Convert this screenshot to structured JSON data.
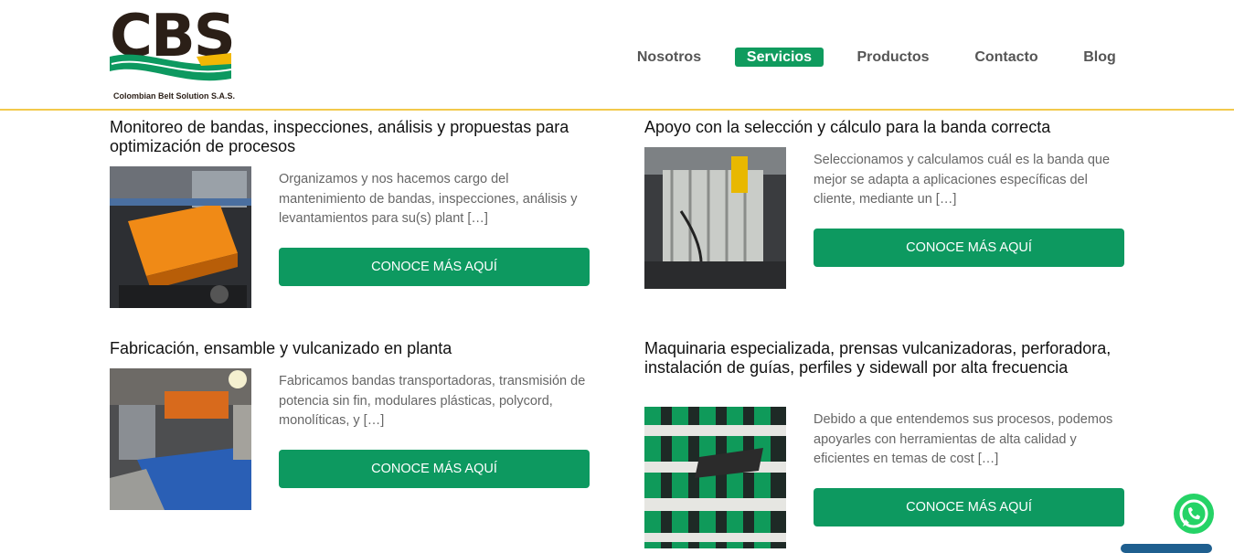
{
  "brand": {
    "logo_text": "CBS",
    "logo_subtitle": "Colombian Belt Solution S.A.S."
  },
  "nav": {
    "items": [
      {
        "label": "Nosotros"
      },
      {
        "label": "Servicios",
        "active": true
      },
      {
        "label": "Productos"
      },
      {
        "label": "Contacto"
      },
      {
        "label": "Blog"
      }
    ]
  },
  "services": [
    {
      "title": "Monitoreo de bandas, inspecciones, análisis y propuestas para optimización de procesos",
      "description": "Organizamos y nos hacemos cargo del mantenimiento de bandas, inspecciones, análisis y levantamientos para su(s) plant […]",
      "button": "CONOCE MÁS AQUÍ"
    },
    {
      "title": "Apoyo con la selección y cálculo para la banda correcta",
      "description": "Seleccionamos y calculamos cuál es la banda que mejor se adapta a aplicaciones específicas del cliente, mediante un […]",
      "button": "CONOCE MÁS AQUÍ"
    },
    {
      "title": "Fabricación, ensamble y vulcanizado en planta",
      "description": "Fabricamos bandas transportadoras, transmisión de potencia sin fin, modulares plásticas, polycord, monolíticas,  y […]",
      "button": "CONOCE MÁS AQUÍ"
    },
    {
      "title": "Maquinaria especializada, prensas vulcanizadoras, perforadora, instalación de guías, perfiles y sidewall por alta frecuencia",
      "description": "Debido a que entendemos sus procesos, podemos apoyarles con herramientas de alta calidad y eficientes en temas de cost […]",
      "button": "CONOCE MÁS AQUÍ"
    }
  ],
  "colors": {
    "accent": "#0d9960",
    "header_border": "#f2c94c",
    "whatsapp": "#25d366"
  },
  "icons": {
    "floating": "whatsapp-icon"
  }
}
